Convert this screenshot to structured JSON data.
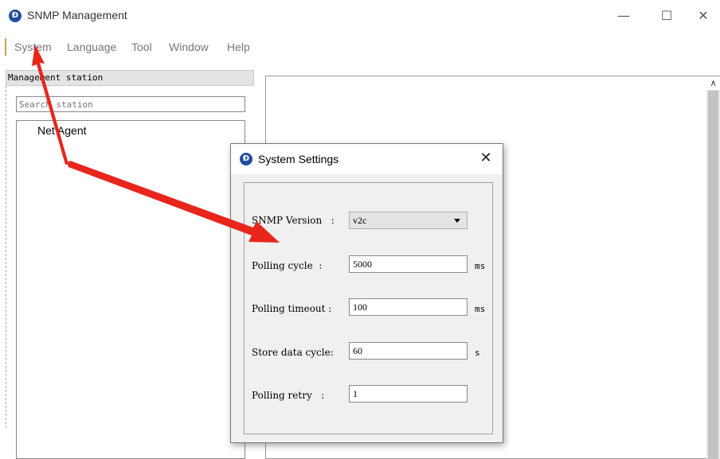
{
  "window": {
    "title": "SNMP Management",
    "icon_glyph": "Ɖ",
    "minimize": "—",
    "maximize": "☐",
    "close": "✕"
  },
  "menu": {
    "items": [
      "System",
      "Language",
      "Tool",
      "Window",
      "Help"
    ]
  },
  "left_panel": {
    "header": "Management station",
    "search_placeholder": "Search station",
    "tree": [
      "Net Agent"
    ]
  },
  "right_panel": {
    "scroll_up_glyph": "∧"
  },
  "dialog": {
    "title": "System Settings",
    "icon_glyph": "Ɖ",
    "close": "✕",
    "fields": [
      {
        "label": "SNMP Version   :",
        "value": "v2c",
        "unit": "",
        "type": "select"
      },
      {
        "label": "Polling cycle  :",
        "value": "5000",
        "unit": "ms",
        "type": "text"
      },
      {
        "label": "Polling timeout :",
        "value": "100",
        "unit": "ms",
        "type": "text"
      },
      {
        "label": "Store data cycle:",
        "value": "60",
        "unit": "s",
        "type": "text"
      },
      {
        "label": "Polling retry   :",
        "value": "1",
        "unit": "",
        "type": "text"
      }
    ]
  },
  "colors": {
    "annotation_arrow": "#e8261c",
    "icon_blue": "#1f4e9c"
  }
}
